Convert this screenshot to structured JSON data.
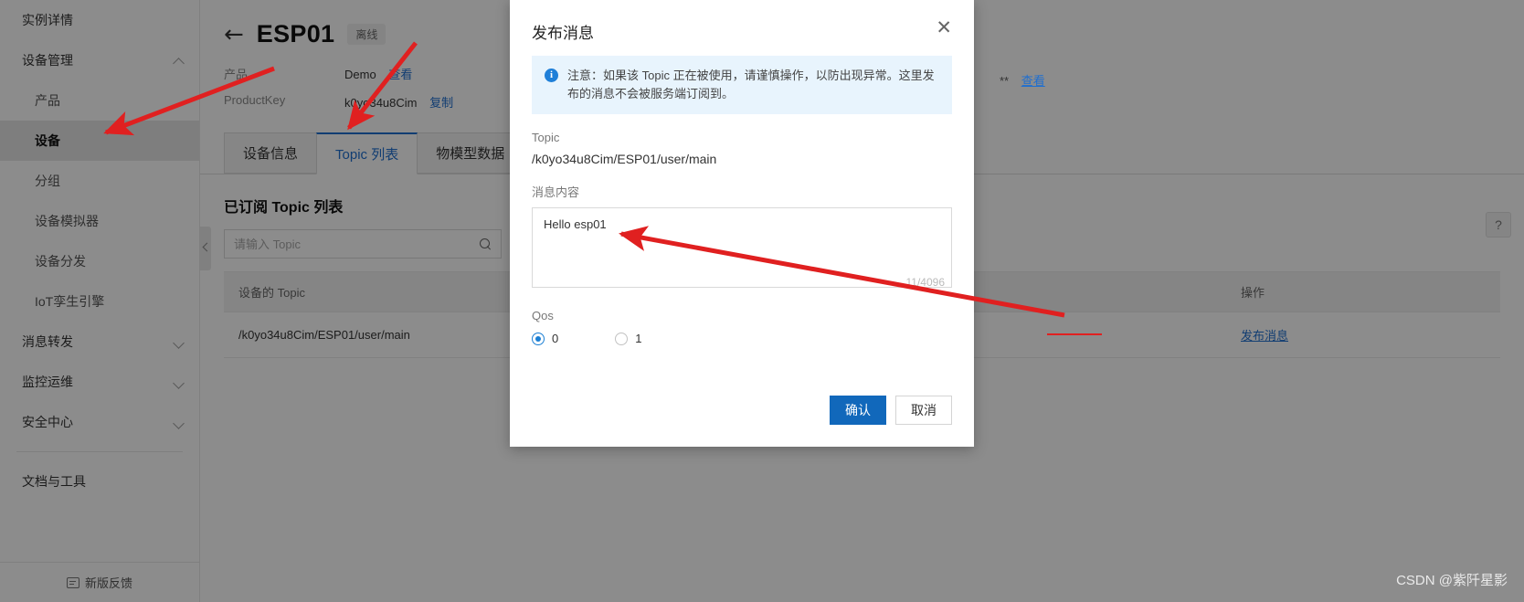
{
  "sidebar": {
    "items": [
      {
        "label": "实例详情",
        "level": "top",
        "chevron": "none",
        "active": false
      },
      {
        "label": "设备管理",
        "level": "top",
        "chevron": "up",
        "active": false
      },
      {
        "label": "产品",
        "level": "sub",
        "chevron": "none",
        "active": false
      },
      {
        "label": "设备",
        "level": "sub",
        "chevron": "none",
        "active": true
      },
      {
        "label": "分组",
        "level": "sub",
        "chevron": "none",
        "active": false
      },
      {
        "label": "设备模拟器",
        "level": "sub",
        "chevron": "none",
        "active": false
      },
      {
        "label": "设备分发",
        "level": "sub",
        "chevron": "none",
        "active": false
      },
      {
        "label": "IoT孪生引擎",
        "level": "sub",
        "chevron": "none",
        "active": false
      },
      {
        "label": "消息转发",
        "level": "top",
        "chevron": "down",
        "active": false
      },
      {
        "label": "监控运维",
        "level": "top",
        "chevron": "down",
        "active": false
      },
      {
        "label": "安全中心",
        "level": "top",
        "chevron": "down",
        "active": false
      },
      {
        "label": "文档与工具",
        "level": "top",
        "chevron": "none",
        "active": false,
        "after_separator": true
      }
    ],
    "footer_label": "新版反馈",
    "footer_icon": "feedback-icon"
  },
  "header": {
    "back_icon": "back-arrow-icon",
    "device_name": "ESP01",
    "status": "离线",
    "meta": [
      {
        "key": "产品",
        "value": "Demo",
        "action": "查看"
      },
      {
        "key": "ProductKey",
        "value": "k0yo34u8Cim",
        "action": "复制"
      }
    ],
    "right_masked_value": "**",
    "right_action": "查看"
  },
  "tabs": [
    {
      "label": "设备信息",
      "active": false
    },
    {
      "label": "Topic 列表",
      "active": true
    },
    {
      "label": "物模型数据",
      "active": false
    }
  ],
  "content": {
    "section_title": "已订阅 Topic 列表",
    "search": {
      "placeholder": "请输入 Topic",
      "value": "",
      "icon": "search-icon"
    },
    "table": {
      "columns": [
        "设备的 Topic",
        "操作"
      ],
      "rows": [
        {
          "topic": "/k0yo34u8Cim/ESP01/user/main",
          "action": "发布消息"
        }
      ]
    },
    "help_icon": "question-mark-icon"
  },
  "modal": {
    "title": "发布消息",
    "close_icon": "close-icon",
    "alert": {
      "icon": "info-icon",
      "text": "注意：如果该 Topic 正在被使用，请谨慎操作，以防出现异常。这里发布的消息不会被服务端订阅到。"
    },
    "topic_label": "Topic",
    "topic_value": "/k0yo34u8Cim/ESP01/user/main",
    "message_label": "消息内容",
    "message_value": "Hello esp01",
    "message_counter": "11/4096",
    "qos_label": "Qos",
    "qos_options": [
      {
        "label": "0",
        "selected": true
      },
      {
        "label": "1",
        "selected": false
      }
    ],
    "confirm_label": "确认",
    "cancel_label": "取消"
  },
  "watermark": "CSDN @紫阡星影",
  "colors": {
    "accent": "#1f6fd0",
    "primary_button": "#1168bb",
    "annotation": "#e02020",
    "alert_bg": "#e8f4fd"
  }
}
